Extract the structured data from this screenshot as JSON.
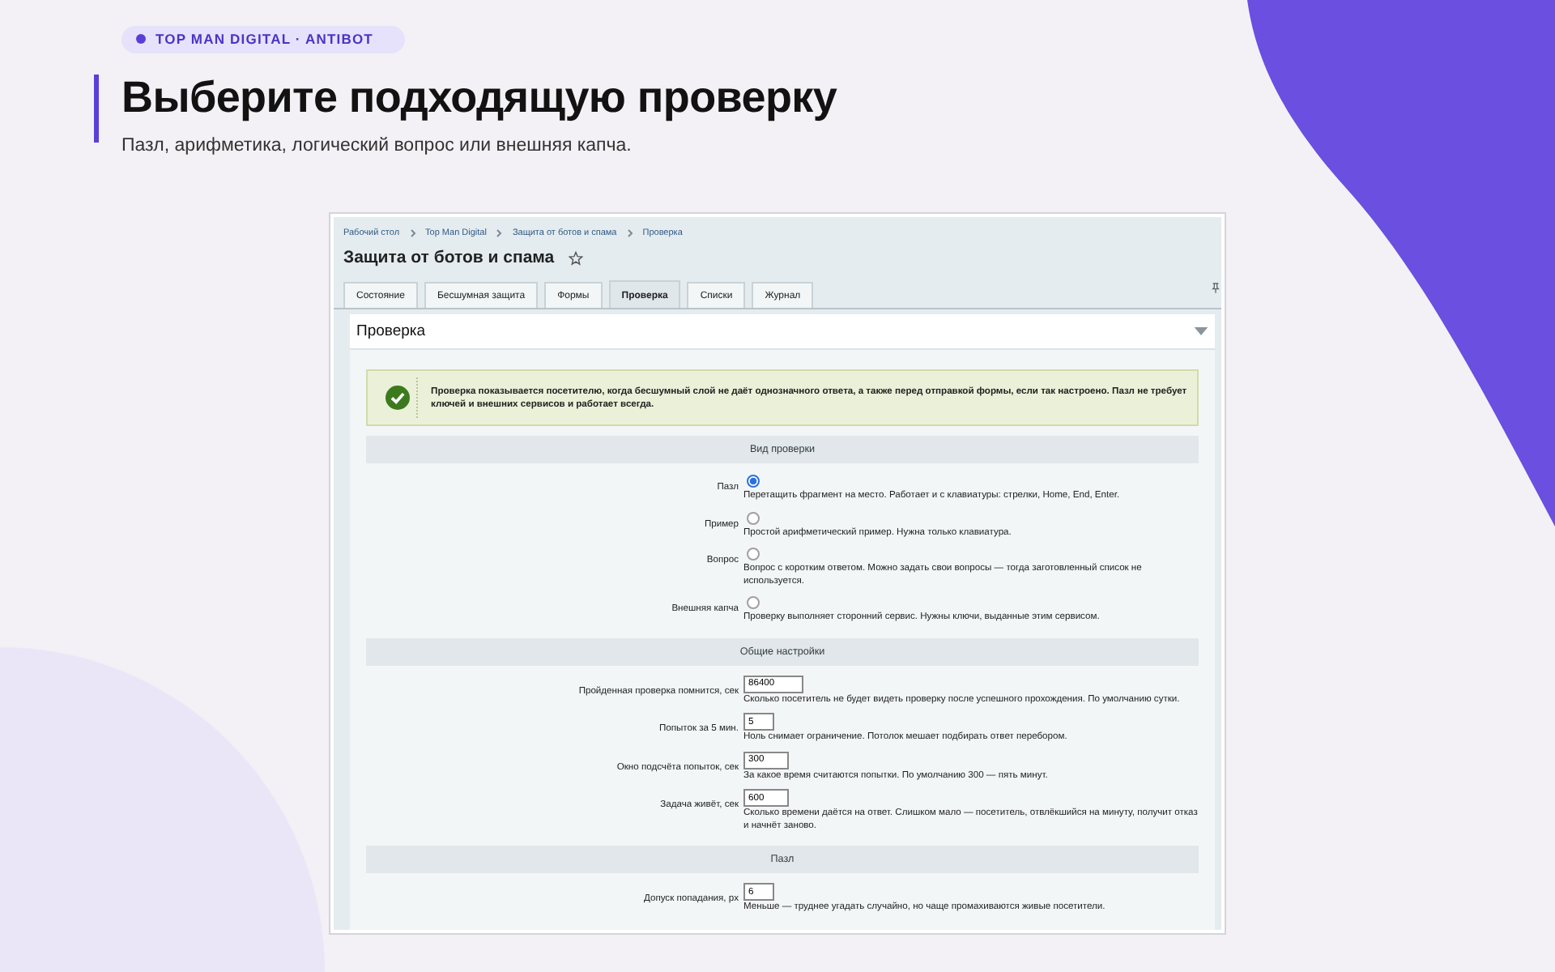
{
  "header": {
    "badge": "TOP MAN DIGITAL · ANTIBOT",
    "title": "Выберите подходящую проверку",
    "subtitle": "Пазл, арифметика, логический вопрос или внешняя капча."
  },
  "admin": {
    "breadcrumbs": [
      "Рабочий стол",
      "Top Man Digital",
      "Защита от ботов и спама",
      "Проверка"
    ],
    "page_title": "Защита от ботов и спама",
    "tabs": [
      {
        "label": "Состояние",
        "selected": false
      },
      {
        "label": "Бесшумная защита",
        "selected": false
      },
      {
        "label": "Формы",
        "selected": false
      },
      {
        "label": "Проверка",
        "selected": true
      },
      {
        "label": "Списки",
        "selected": false
      },
      {
        "label": "Журнал",
        "selected": false
      }
    ],
    "section_title": "Проверка",
    "notice": "Проверка показывается посетителю, когда бесшумный слой не даёт однозначного ответа, а также перед отправкой формы, если так настроено. Пазл не требует ключей и внешних сервисов и работает всегда.",
    "groups": [
      {
        "heading": "Вид проверки",
        "fields": [
          {
            "kind": "radio",
            "label": "Пазл",
            "selected": true,
            "hint": "Перетащить фрагмент на место. Работает и с клавиатуры: стрелки, Home, End, Enter."
          },
          {
            "kind": "radio",
            "label": "Пример",
            "selected": false,
            "hint": "Простой арифметический пример. Нужна только клавиатура."
          },
          {
            "kind": "radio",
            "label": "Вопрос",
            "selected": false,
            "hint": "Вопрос с коротким ответом. Можно задать свои вопросы — тогда заготовленный список не используется."
          },
          {
            "kind": "radio",
            "label": "Внешняя капча",
            "selected": false,
            "hint": "Проверку выполняет сторонний сервис. Нужны ключи, выданные этим сервисом."
          }
        ]
      },
      {
        "heading": "Общие настройки",
        "fields": [
          {
            "kind": "number",
            "label": "Пройденная проверка помнится, сек",
            "value": "86400",
            "hint": "Сколько посетитель не будет видеть проверку после успешного прохождения. По умолчанию сутки."
          },
          {
            "kind": "number",
            "label": "Попыток за 5 мин.",
            "value": "5",
            "hint": "Ноль снимает ограничение. Потолок мешает подбирать ответ перебором."
          },
          {
            "kind": "number",
            "label": "Окно подсчёта попыток, сек",
            "value": "300",
            "hint": "За какое время считаются попытки. По умолчанию 300 — пять минут."
          },
          {
            "kind": "number",
            "label": "Задача живёт, сек",
            "value": "600",
            "hint": "Сколько времени даётся на ответ. Слишком мало — посетитель, отвлёкшийся на минуту, получит отказ и начнёт заново."
          }
        ]
      },
      {
        "heading": "Пазл",
        "fields": [
          {
            "kind": "number",
            "label": "Допуск попадания, px",
            "value": "6",
            "hint": "Меньше — труднее угадать случайно, но чаще промахиваются живые посетители."
          }
        ]
      }
    ]
  }
}
